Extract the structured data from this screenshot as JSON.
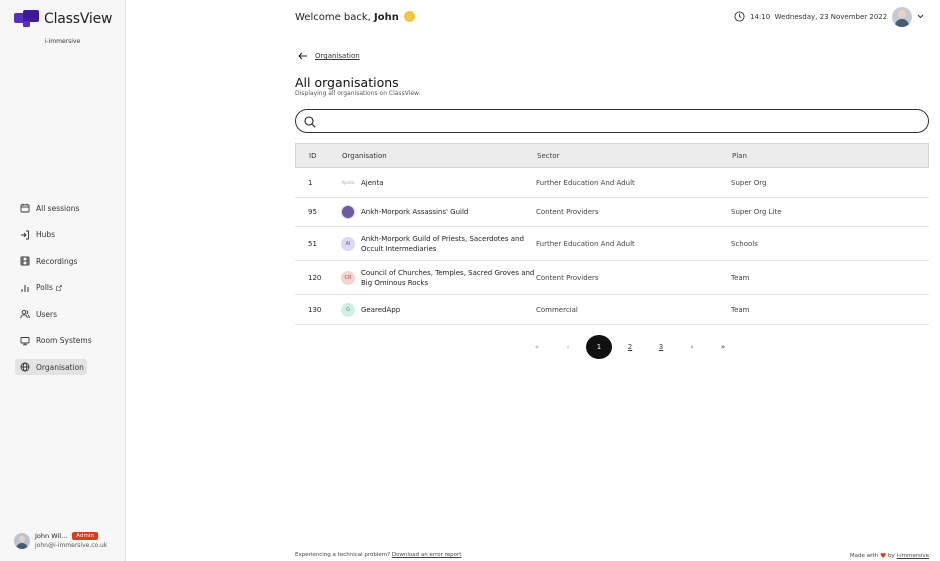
{
  "brand": {
    "name": "ClassView",
    "sub": "i-immersive",
    "colors": [
      "#5a2fbf",
      "#3d1a9e"
    ]
  },
  "nav": [
    {
      "label": "All sessions",
      "icon": "calendar-icon"
    },
    {
      "label": "Hubs",
      "icon": "login-icon"
    },
    {
      "label": "Recordings",
      "icon": "film-icon"
    },
    {
      "label": "Polls",
      "icon": "bar-chart-icon",
      "external": true
    },
    {
      "label": "Users",
      "icon": "users-icon"
    },
    {
      "label": "Room Systems",
      "icon": "monitor-icon"
    },
    {
      "label": "Organisation",
      "icon": "globe-icon",
      "active": true
    }
  ],
  "user": {
    "name": "John Wil...",
    "role": "Admin",
    "email": "john@i-immersive.co.uk"
  },
  "header": {
    "welcome_prefix": "Welcome back, ",
    "welcome_name": "John",
    "time": "14:10",
    "date": "Wednesday, 23 November 2022"
  },
  "breadcrumb": "Organisation",
  "page": {
    "title": "All organisations",
    "subtitle": "Displaying all organisations on ClassView."
  },
  "search": {
    "placeholder": "",
    "value": ""
  },
  "table": {
    "columns": [
      "ID",
      "Organisation",
      "Sector",
      "Plan"
    ],
    "rows": [
      {
        "id": "1",
        "logo": "Ajenta",
        "logo_type": "text",
        "name": "Ajenta",
        "sector": "Further Education And Adult",
        "plan": "Super Org"
      },
      {
        "id": "95",
        "logo": "",
        "logo_type": "img",
        "name": "Ankh-Morpork Assassins' Guild",
        "sector": "Content Providers",
        "plan": "Super Org Lite"
      },
      {
        "id": "51",
        "logo": "AI",
        "logo_type": "ai",
        "name": "Ankh-Morpork Guild of Priests, Sacerdotes and Occult Intermediaries",
        "sector": "Further Education And Adult",
        "plan": "Schools"
      },
      {
        "id": "120",
        "logo": "CR",
        "logo_type": "cr",
        "name": "Council of Churches, Temples, Sacred Groves and Big Ominous Rocks",
        "sector": "Content Providers",
        "plan": "Team"
      },
      {
        "id": "130",
        "logo": "G",
        "logo_type": "g",
        "name": "GearedApp",
        "sector": "Commercial",
        "plan": "Team"
      }
    ]
  },
  "pagination": {
    "first": "«",
    "prev": "‹",
    "pages": [
      "1",
      "2",
      "3"
    ],
    "current": "1",
    "next": "›",
    "last": "»"
  },
  "footer": {
    "left_text": "Experiencing a technical problem? ",
    "left_link": "Download an error report",
    "right_prefix": "Made with ",
    "right_by": " by ",
    "right_link": "i-immersive"
  }
}
